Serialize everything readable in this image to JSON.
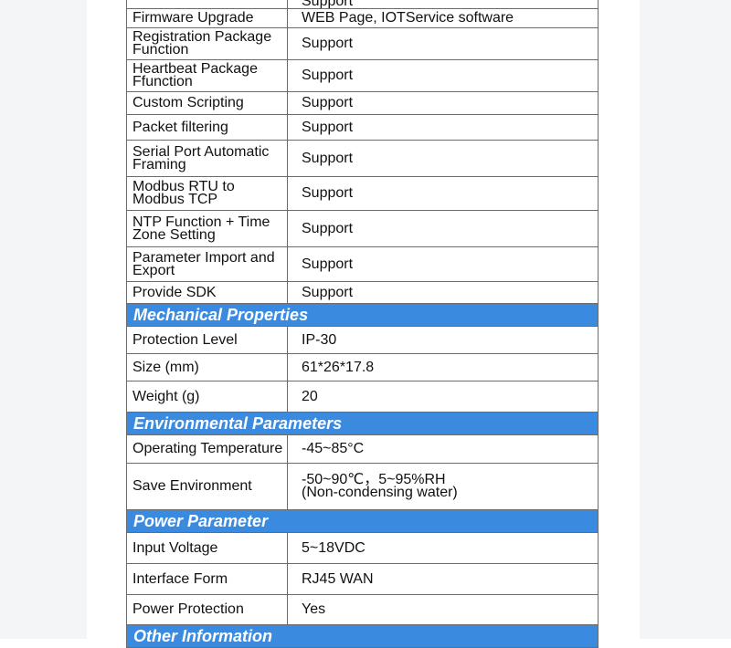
{
  "spec_table": {
    "groups": [
      {
        "header": "",
        "rows": [
          {
            "label": "",
            "value": "Support"
          },
          {
            "label": "Firmware Upgrade",
            "value": "WEB Page, IOTService software"
          },
          {
            "label": "Registration Package Function",
            "value": "Support"
          },
          {
            "label": "Heartbeat Package Ffunction",
            "value": "Support"
          },
          {
            "label": "Custom Scripting",
            "value": "Support"
          },
          {
            "label": "Packet filtering",
            "value": "Support"
          },
          {
            "label": "Serial Port Automatic Framing",
            "value": "Support"
          },
          {
            "label": "Modbus RTU to Modbus TCP",
            "value": "Support"
          },
          {
            "label": "NTP Function + Time Zone Setting",
            "value": "Support"
          },
          {
            "label": "Parameter Import and Export",
            "value": "Support"
          },
          {
            "label": "Provide SDK",
            "value": "Support"
          }
        ]
      },
      {
        "header": "Mechanical Properties",
        "rows": [
          {
            "label": "Protection Level",
            "value": "IP-30"
          },
          {
            "label": "Size (mm)",
            "value": "61*26*17.8"
          },
          {
            "label": "Weight (g)",
            "value": "20"
          }
        ]
      },
      {
        "header": "Environmental Parameters",
        "rows": [
          {
            "label": "Operating Temperature",
            "value": "-45~85°C"
          },
          {
            "label": "Save Environment",
            "value": "-50~90℃，5~95%RH (Non-condensing water)"
          }
        ]
      },
      {
        "header": "Power Parameter",
        "rows": [
          {
            "label": "Input Voltage",
            "value": "5~18VDC"
          },
          {
            "label": "Interface Form",
            "value": "RJ45 WAN"
          },
          {
            "label": "Power Protection",
            "value": "Yes"
          }
        ]
      },
      {
        "header": "Other Information",
        "rows": []
      }
    ]
  }
}
